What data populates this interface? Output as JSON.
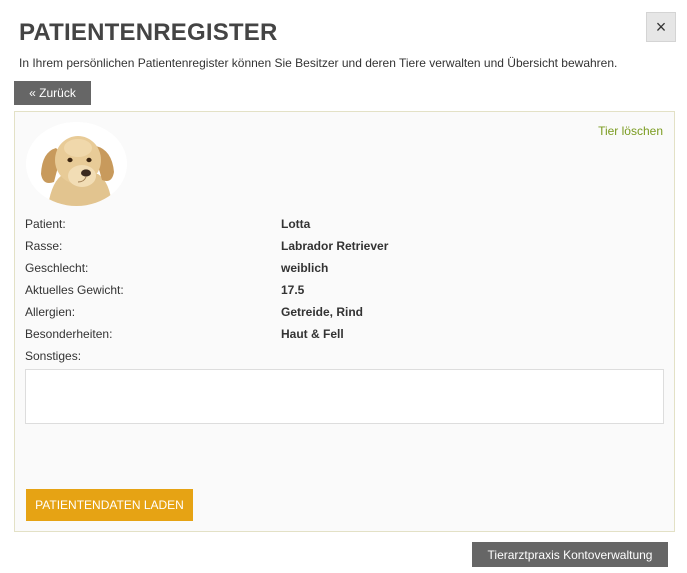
{
  "header": {
    "title": "PATIENTENREGISTER",
    "subtitle": "In Ihrem persönlichen Patientenregister können Sie Besitzer und deren Tiere verwalten und Übersicht bewahren.",
    "close_symbol": "×",
    "back_label": "« Zurück"
  },
  "patient": {
    "delete_label": "Tier löschen",
    "avatar_icon": "dog-photo",
    "fields": [
      {
        "label": "Patient:",
        "value": "Lotta"
      },
      {
        "label": "Rasse:",
        "value": "Labrador Retriever"
      },
      {
        "label": "Geschlecht:",
        "value": "weiblich"
      },
      {
        "label": "Aktuelles Gewicht:",
        "value": "17.5"
      },
      {
        "label": "Allergien:",
        "value": "Getreide, Rind"
      },
      {
        "label": "Besonderheiten:",
        "value": "Haut & Fell"
      },
      {
        "label": "Sonstiges:",
        "value": ""
      }
    ],
    "notes_value": "",
    "load_button": "PATIENTENDATEN LADEN"
  },
  "footer": {
    "account_button": "Tierarztpraxis Kontoverwaltung"
  },
  "colors": {
    "accent_orange": "#e6a314",
    "link_green": "#7a9b1f",
    "button_grey": "#666666"
  }
}
